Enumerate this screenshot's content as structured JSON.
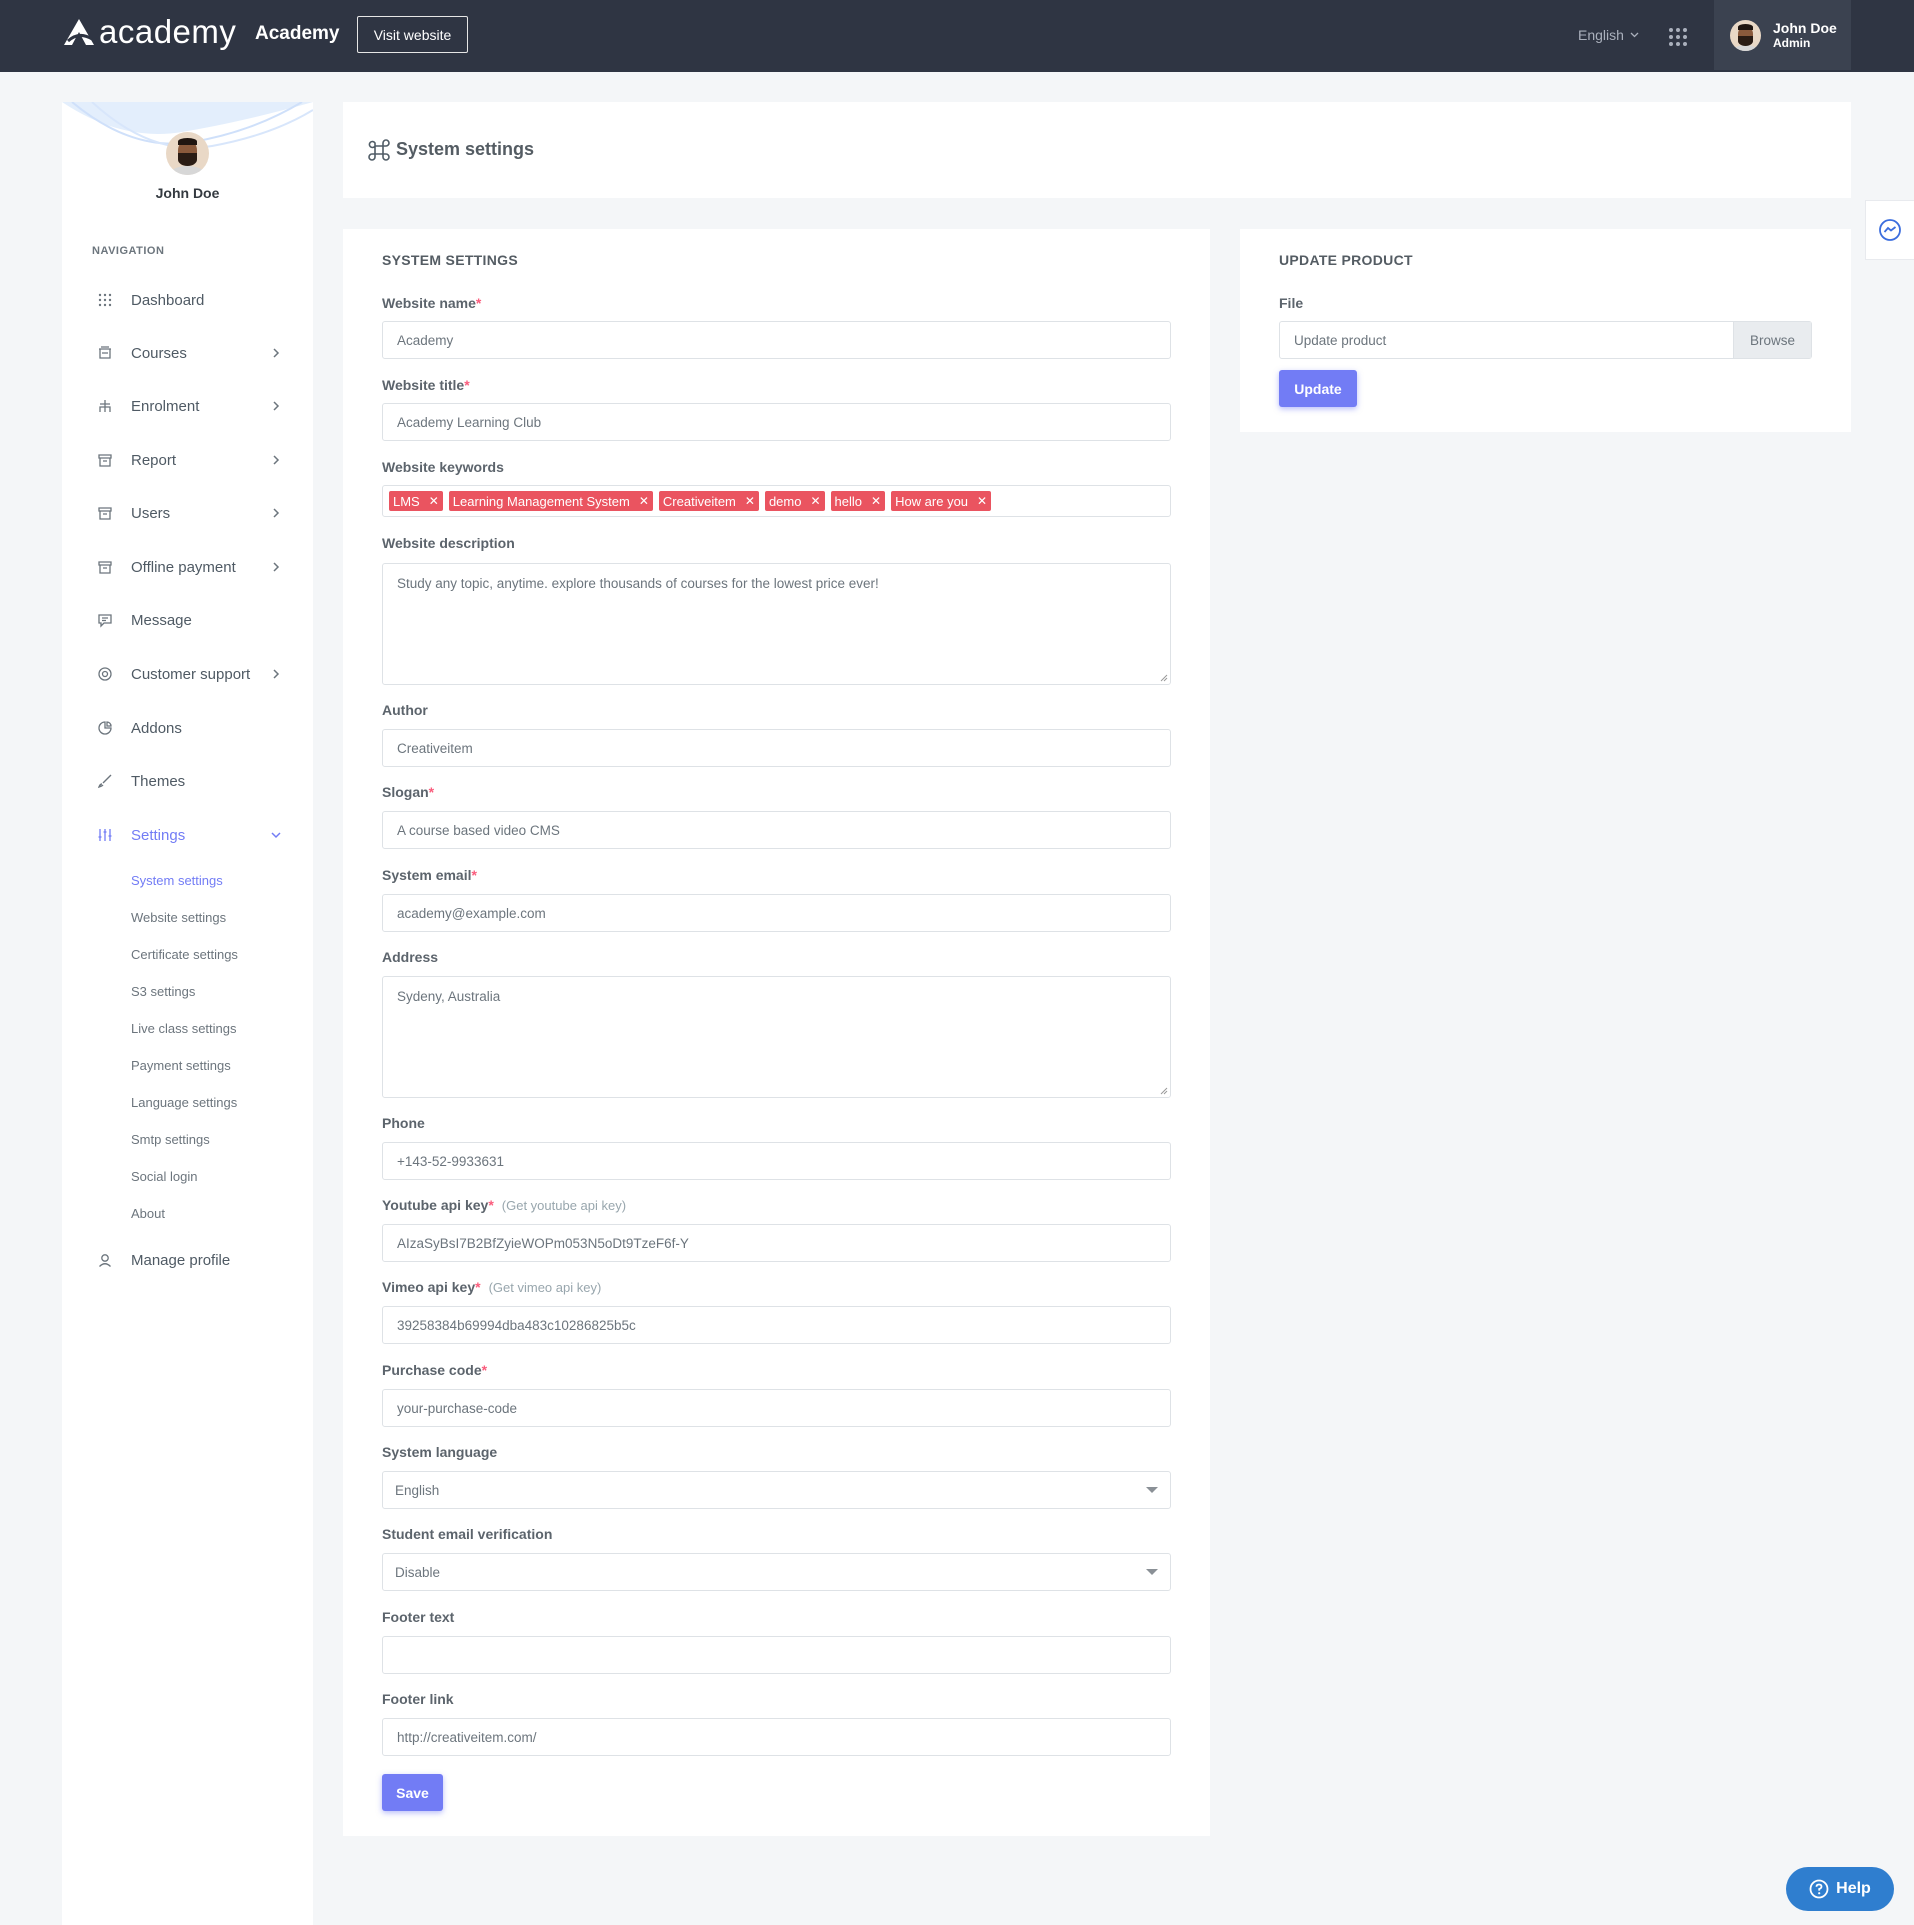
{
  "topbar": {
    "logo_text": "academy",
    "brand_title": "Academy",
    "visit_label": "Visit website",
    "language": "English",
    "user_name": "John Doe",
    "user_role": "Admin"
  },
  "sidebar": {
    "profile_name": "John Doe",
    "nav_title": "NAVIGATION",
    "items": [
      {
        "label": "Dashboard",
        "icon": "dashboard-icon"
      },
      {
        "label": "Courses",
        "icon": "courses-icon"
      },
      {
        "label": "Enrolment",
        "icon": "enrolment-icon"
      },
      {
        "label": "Report",
        "icon": "report-icon"
      },
      {
        "label": "Users",
        "icon": "users-icon"
      },
      {
        "label": "Offline payment",
        "icon": "offline-payment-icon"
      },
      {
        "label": "Message",
        "icon": "message-icon"
      },
      {
        "label": "Customer support",
        "icon": "support-icon"
      },
      {
        "label": "Addons",
        "icon": "addons-icon"
      },
      {
        "label": "Themes",
        "icon": "brush-icon"
      },
      {
        "label": "Settings",
        "icon": "settings-sliders-icon"
      },
      {
        "label": "Manage profile",
        "icon": "user-icon"
      }
    ],
    "settings_sub": [
      "System settings",
      "Website settings",
      "Certificate settings",
      "S3 settings",
      "Live class settings",
      "Payment settings",
      "Language settings",
      "Smtp settings",
      "Social login",
      "About"
    ]
  },
  "page": {
    "title": "System settings"
  },
  "system_settings": {
    "title": "SYSTEM SETTINGS",
    "website_name_label": "Website name",
    "website_name": "Academy",
    "website_title_label": "Website title",
    "website_title": "Academy Learning Club",
    "keywords_label": "Website keywords",
    "keywords": [
      "LMS",
      "Learning Management System",
      "Creativeitem",
      "demo",
      "hello",
      "How are you"
    ],
    "description_label": "Website description",
    "description": "Study any topic, anytime. explore thousands of courses for the lowest price ever!",
    "author_label": "Author",
    "author": "Creativeitem",
    "slogan_label": "Slogan",
    "slogan": "A course based video CMS",
    "email_label": "System email",
    "email": "academy@example.com",
    "address_label": "Address",
    "address": "Sydeny, Australia",
    "phone_label": "Phone",
    "phone": "+143-52-9933631",
    "youtube_label": "Youtube api key",
    "youtube_hint": "(Get youtube api key)",
    "youtube_key": "AIzaSyBsI7B2BfZyieWOPm053N5oDt9TzeF6f-Y",
    "vimeo_label": "Vimeo api key",
    "vimeo_hint": "(Get vimeo api key)",
    "vimeo_key": "39258384b69994dba483c10286825b5c",
    "purchase_label": "Purchase code",
    "purchase_code": "your-purchase-code",
    "language_label": "System language",
    "language": "English",
    "verification_label": "Student email verification",
    "verification": "Disable",
    "footer_text_label": "Footer text",
    "footer_text": "",
    "footer_link_label": "Footer link",
    "footer_link": "http://creativeitem.com/",
    "save_label": "Save",
    "required_mark": "*"
  },
  "update_product": {
    "title": "UPDATE PRODUCT",
    "file_label": "File",
    "file_placeholder": "Update product",
    "browse_label": "Browse",
    "update_label": "Update"
  },
  "help": {
    "label": "Help"
  },
  "colors": {
    "topbar": "#2f3543",
    "accent": "#727cf5",
    "tag": "#ea5460",
    "help": "#2f7ecf"
  }
}
